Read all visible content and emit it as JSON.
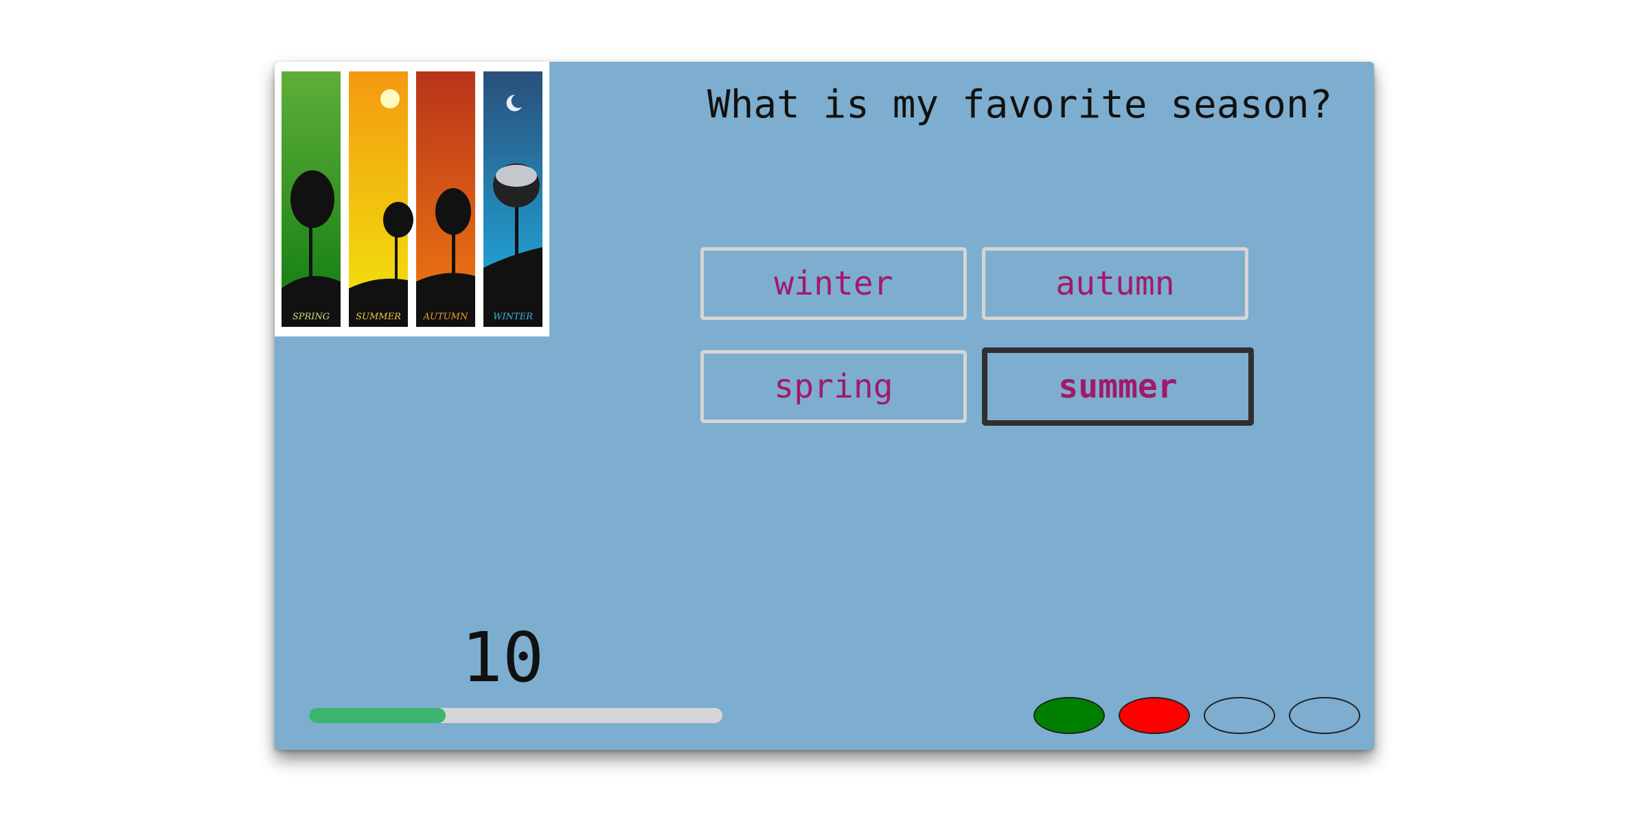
{
  "question": "What is my favorite season?",
  "picture": {
    "panels": [
      {
        "label": "SPRING",
        "color_top": "#5fae3a",
        "color_bottom": "#0e7a10"
      },
      {
        "label": "SUMMER",
        "color_top": "#f39a10",
        "color_bottom": "#f2e60c"
      },
      {
        "label": "AUTUMN",
        "color_top": "#b8341a",
        "color_bottom": "#f27c12"
      },
      {
        "label": "WINTER",
        "color_top": "#2a4f7a",
        "color_bottom": "#1fb4e8"
      }
    ]
  },
  "options": [
    {
      "label": "winter",
      "selected": false
    },
    {
      "label": "autumn",
      "selected": false
    },
    {
      "label": "spring",
      "selected": false
    },
    {
      "label": "summer",
      "selected": true
    }
  ],
  "timer": {
    "value": "10",
    "progress": 0.33,
    "fill_color": "#3cb371"
  },
  "answers": [
    {
      "status": "correct",
      "color": "#008000"
    },
    {
      "status": "wrong",
      "color": "#ff0000"
    },
    {
      "status": "pending",
      "color": "transparent"
    },
    {
      "status": "pending",
      "color": "transparent"
    }
  ]
}
